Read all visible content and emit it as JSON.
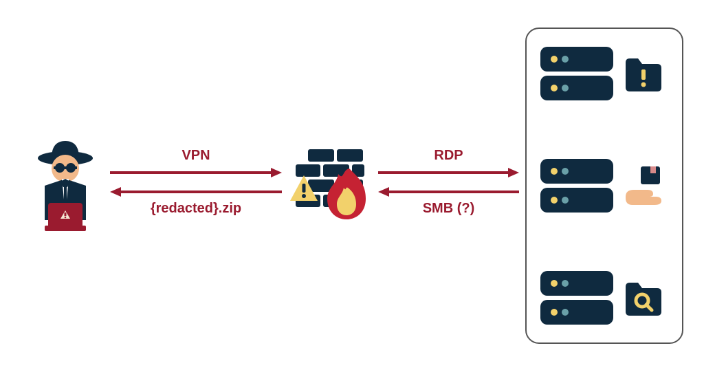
{
  "diagram": {
    "left_arrow": {
      "top_label": "VPN",
      "bottom_label": "{redacted}.zip"
    },
    "right_arrow": {
      "top_label": "RDP",
      "bottom_label": "SMB (?)"
    },
    "nodes": {
      "attacker": "hacker-with-laptop",
      "firewall": "firewall-compromised",
      "servers": [
        {
          "side": "folder-alert"
        },
        {
          "side": "hand-package"
        },
        {
          "side": "folder-search"
        }
      ]
    },
    "colors": {
      "arrow": "#9a1b2f",
      "dark": "#0f2a3f",
      "accent_yellow": "#f2d16b",
      "accent_red": "#c52233",
      "skin": "#f2b98a"
    }
  }
}
